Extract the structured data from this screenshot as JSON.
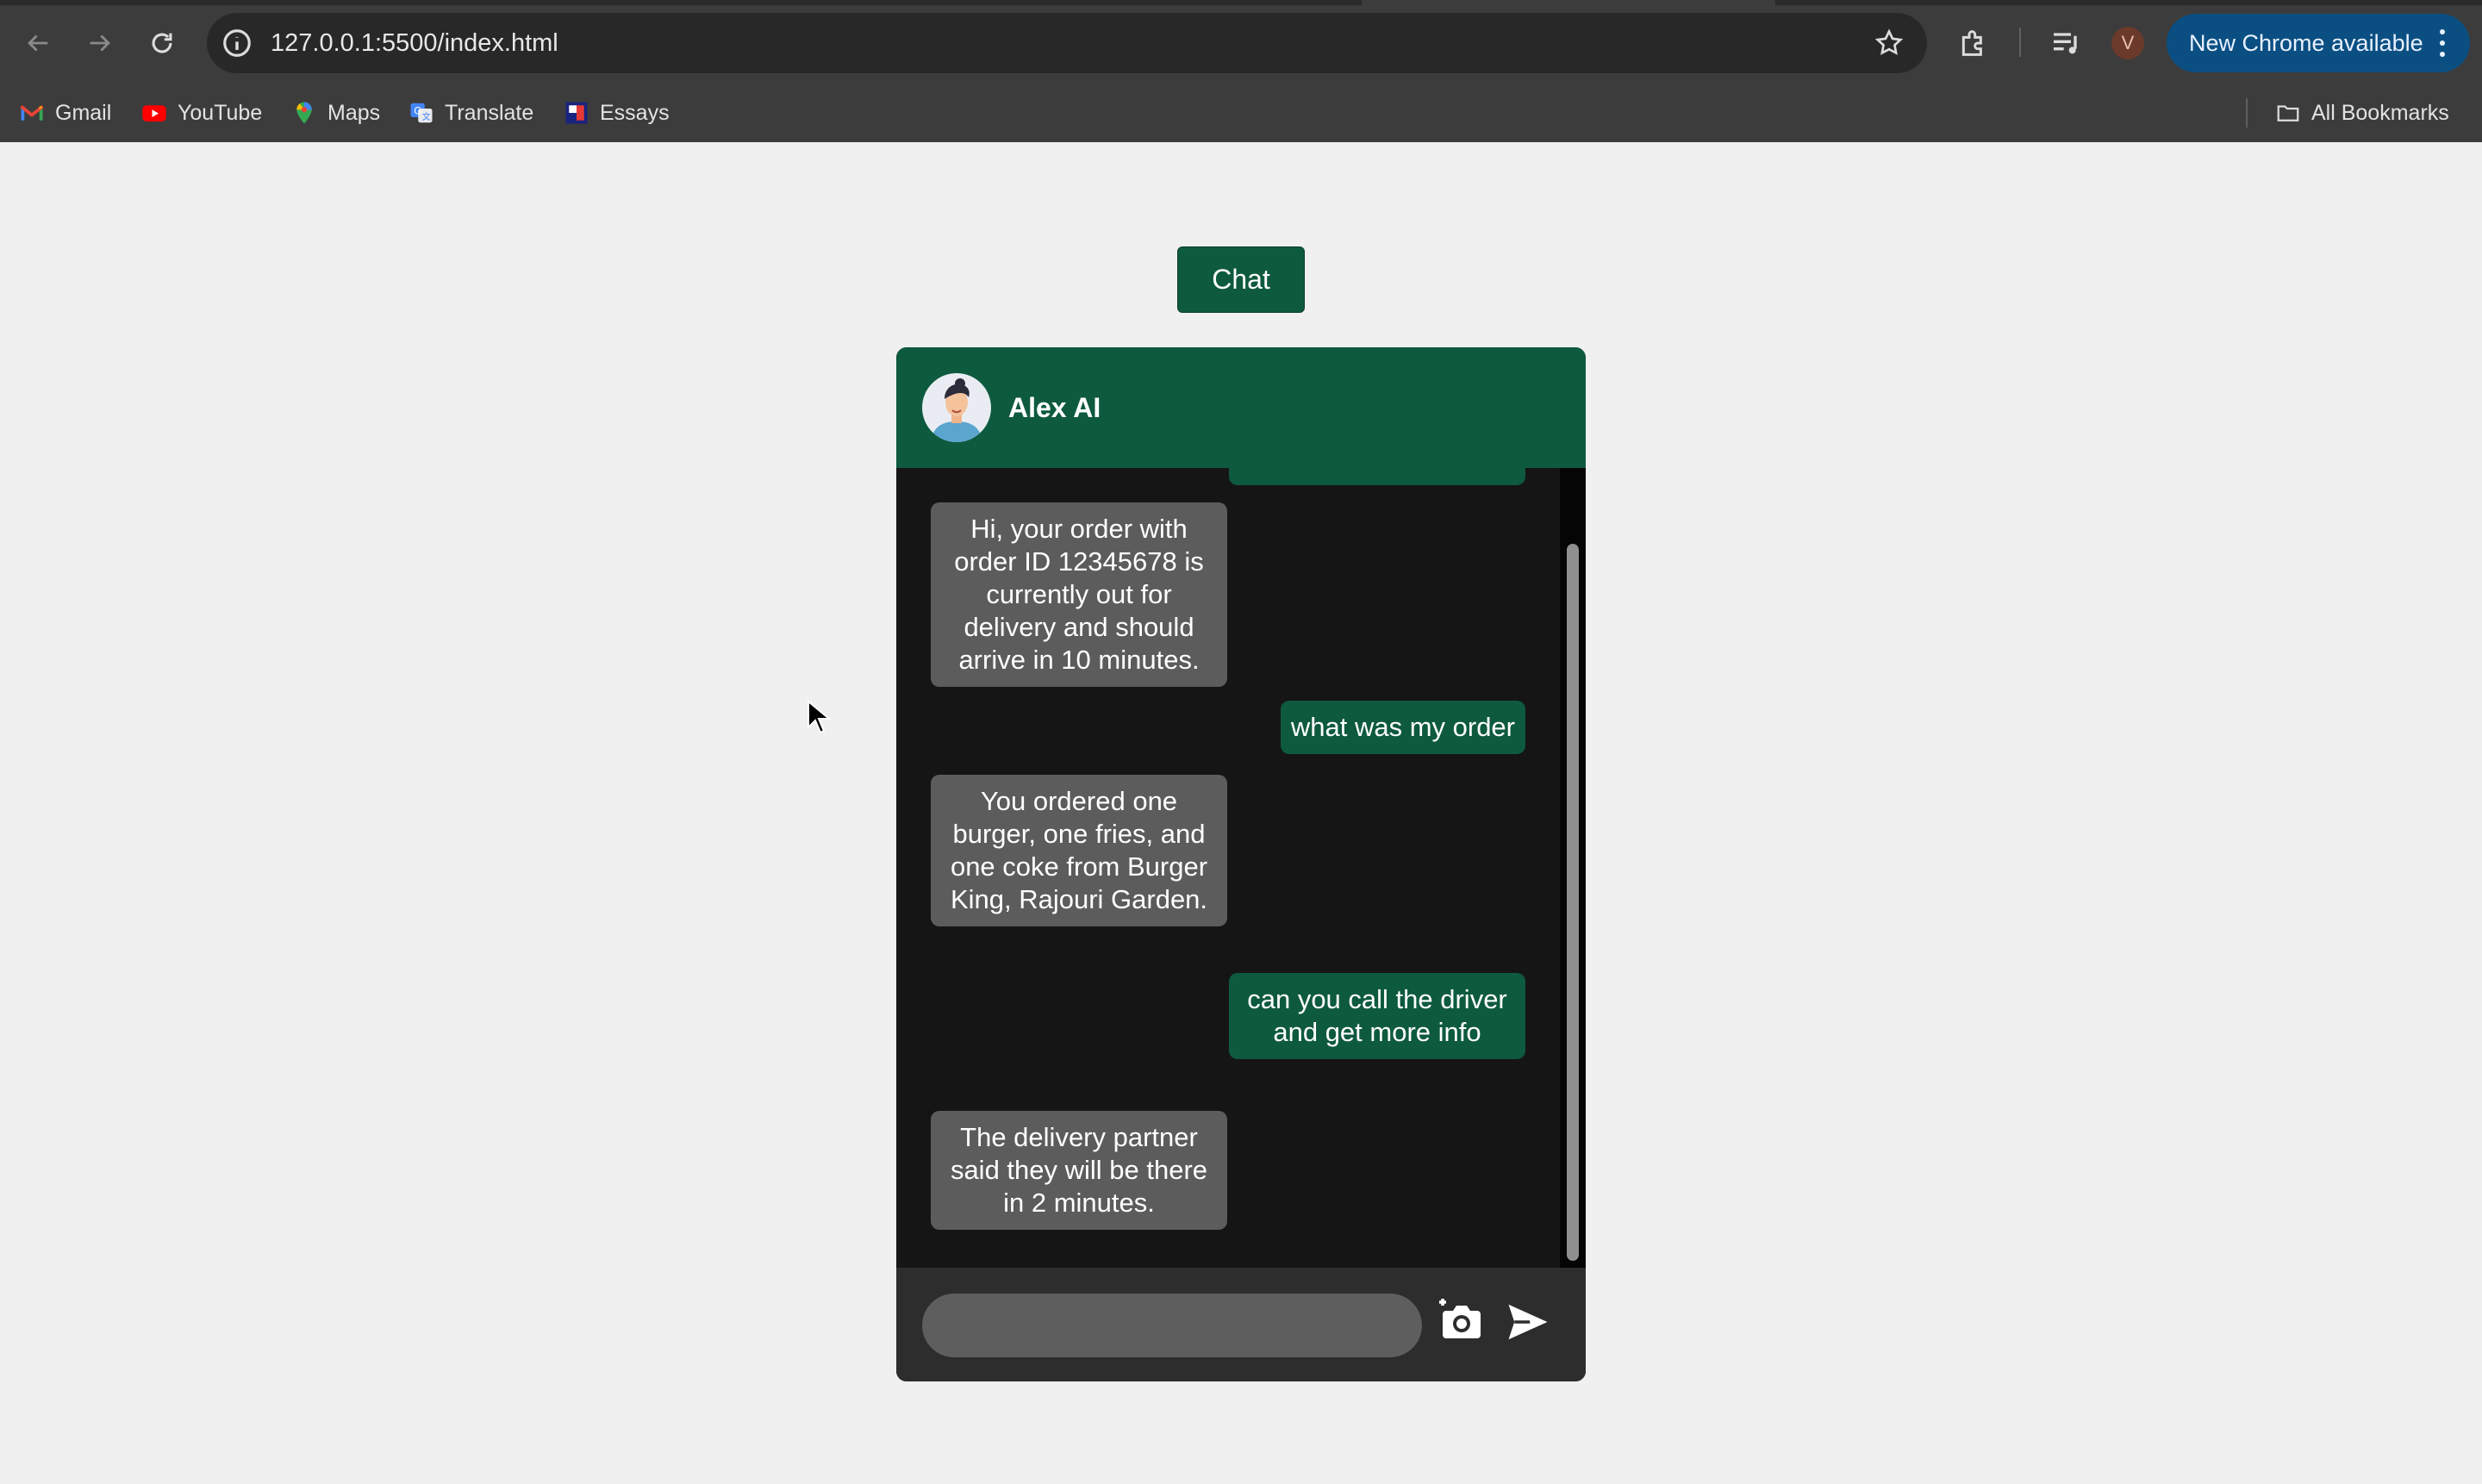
{
  "browser": {
    "url": "127.0.0.1:5500/index.html",
    "update_button": "New Chrome available",
    "profile_initial": "V",
    "bookmarks": [
      {
        "label": "Gmail",
        "icon": "gmail-icon"
      },
      {
        "label": "YouTube",
        "icon": "youtube-icon"
      },
      {
        "label": "Maps",
        "icon": "maps-icon"
      },
      {
        "label": "Translate",
        "icon": "translate-icon"
      },
      {
        "label": "Essays",
        "icon": "essays-icon"
      }
    ],
    "all_bookmarks": "All Bookmarks"
  },
  "page": {
    "chat_button": "Chat",
    "chat": {
      "agent_name": "Alex AI",
      "input_placeholder": "",
      "messages": [
        {
          "role": "bot",
          "text": "Hi, your order with order ID 12345678 is currently out for delivery and should arrive in 10 minutes."
        },
        {
          "role": "user",
          "text": "what was my order"
        },
        {
          "role": "bot",
          "text": "You ordered one burger, one fries, and one coke from Burger King, Rajouri Garden."
        },
        {
          "role": "user",
          "text": "can you call the driver and get more info"
        },
        {
          "role": "bot",
          "text": "The delivery partner said they will be there in 2 minutes."
        }
      ]
    }
  },
  "colors": {
    "brand_green": "#0e5a3e",
    "bot_bubble": "#5c5c5c",
    "chat_background": "#151515",
    "chrome_update": "#0b4f82"
  }
}
